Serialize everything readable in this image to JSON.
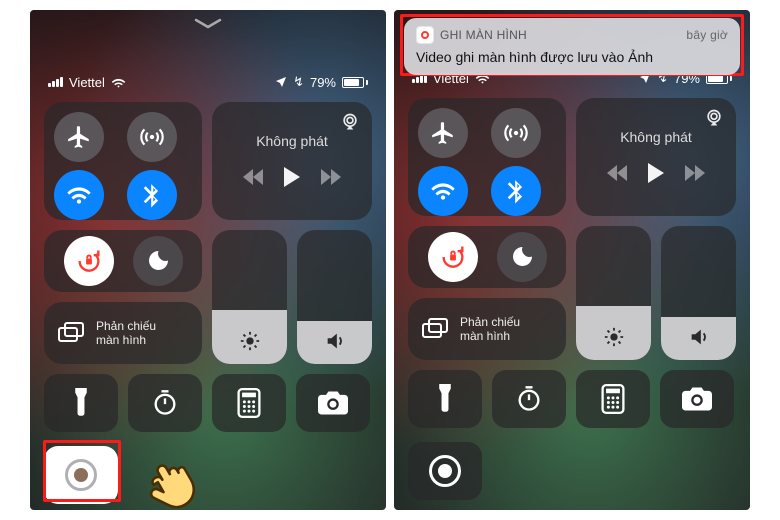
{
  "status": {
    "carrier": "Viettel",
    "battery_percent": "79%"
  },
  "media": {
    "title": "Không phát"
  },
  "mirror": {
    "line1": "Phản chiếu",
    "line2": "màn hình"
  },
  "notification": {
    "app_name": "GHI MÀN HÌNH",
    "when": "bây giờ",
    "body": "Video ghi màn hình được lưu vào Ảnh"
  },
  "colors": {
    "highlight": "#ff1a1a",
    "ios_blue": "#0a84ff",
    "ios_green": "#34c759"
  }
}
